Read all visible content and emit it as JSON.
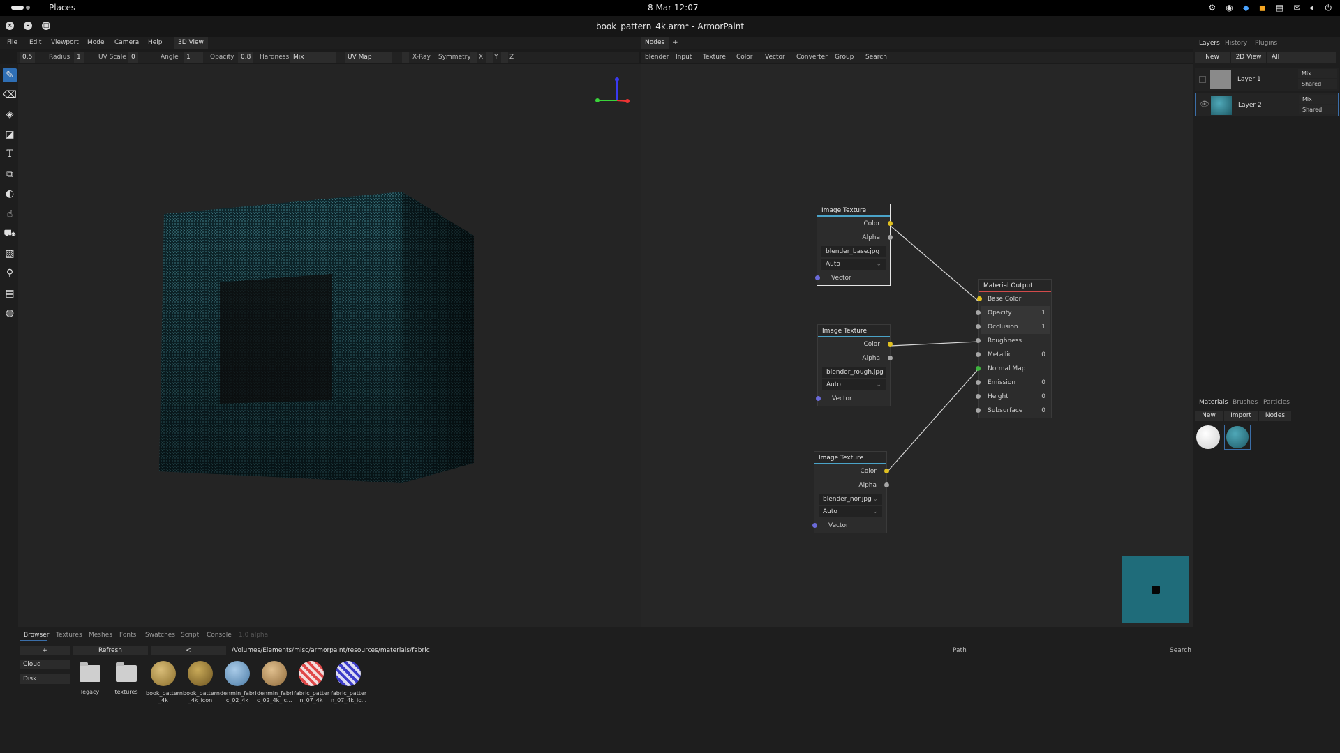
{
  "system": {
    "places": "Places",
    "clock": "8 Mar  12:07",
    "tray_icons": [
      "steam-icon",
      "discord-icon",
      "app-icon",
      "rss-icon",
      "notes-icon",
      "mail-icon",
      "volume-icon",
      "power-icon"
    ]
  },
  "window": {
    "title": "book_pattern_4k.arm* - ArmorPaint"
  },
  "menu": {
    "items": [
      "File",
      "Edit",
      "Viewport",
      "Mode",
      "Camera",
      "Help"
    ],
    "active_tab": "3D View"
  },
  "tool_options": {
    "brush_size": "0.5",
    "radius_label": "Radius",
    "radius": "1",
    "uvscale_label": "UV Scale",
    "uvscale": "0",
    "angle_label": "Angle",
    "angle": "1",
    "opacity_label": "Opacity",
    "opacity": "0.8",
    "hardness_label": "Hardness",
    "blend": "Mix",
    "uvmap": "UV Map",
    "xray": "X-Ray",
    "symmetry": "Symmetry",
    "x": "X",
    "y": "Y",
    "z": "Z"
  },
  "nodes": {
    "tab": "Nodes",
    "add": "+",
    "categories": [
      "blender",
      "Input",
      "Texture",
      "Color",
      "Vector",
      "Converter",
      "Group",
      "Search"
    ],
    "image_textures": [
      {
        "title": "Image Texture",
        "color": "Color",
        "alpha": "Alpha",
        "file": "blender_base.jpg",
        "mode": "Auto",
        "vector": "Vector"
      },
      {
        "title": "Image Texture",
        "color": "Color",
        "alpha": "Alpha",
        "file": "blender_rough.jpg",
        "mode": "Auto",
        "vector": "Vector"
      },
      {
        "title": "Image Texture",
        "color": "Color",
        "alpha": "Alpha",
        "file": "blender_nor.jpg",
        "mode": "Auto",
        "vector": "Vector"
      }
    ],
    "output": {
      "title": "Material Output",
      "inputs": [
        {
          "label": "Base Color",
          "value": ""
        },
        {
          "label": "Opacity",
          "value": "1"
        },
        {
          "label": "Occlusion",
          "value": "1"
        },
        {
          "label": "Roughness",
          "value": ""
        },
        {
          "label": "Metallic",
          "value": "0"
        },
        {
          "label": "Normal Map",
          "value": ""
        },
        {
          "label": "Emission",
          "value": "0"
        },
        {
          "label": "Height",
          "value": "0"
        },
        {
          "label": "Subsurface",
          "value": "0"
        }
      ]
    }
  },
  "right_panel": {
    "tabs": [
      "Layers",
      "History",
      "Plugins"
    ],
    "new": "New",
    "view2d": "2D View",
    "filter": "All",
    "layers": [
      {
        "name": "Layer 1",
        "blend": "Mix",
        "mode": "Shared"
      },
      {
        "name": "Layer 2",
        "blend": "Mix",
        "mode": "Shared"
      }
    ],
    "mat_tabs": [
      "Materials",
      "Brushes",
      "Particles"
    ],
    "mat_new": "New",
    "mat_import": "Import",
    "mat_nodes": "Nodes"
  },
  "browser": {
    "tabs": [
      "Browser",
      "Textures",
      "Meshes",
      "Fonts",
      "Swatches",
      "Script",
      "Console",
      "1.0 alpha"
    ],
    "add": "+",
    "refresh": "Refresh",
    "back": "<",
    "path": "/Volumes/Elements/misc/armorpaint/resources/materials/fabric",
    "path_label": "Path",
    "search": "Search",
    "locations": [
      "Cloud",
      "Disk"
    ],
    "assets": [
      {
        "name": "legacy",
        "kind": "folder",
        "color": ""
      },
      {
        "name": "textures",
        "kind": "folder",
        "color": ""
      },
      {
        "name": "book_pattern_4k",
        "kind": "material",
        "color": "#c9a960"
      },
      {
        "name": "book_pattern_4k_icon",
        "kind": "material",
        "color": "#b89a4a"
      },
      {
        "name": "denmin_fabric_02_4k",
        "kind": "material",
        "color": "#7fa9cf"
      },
      {
        "name": "denmin_fabric_02_4k_ic...",
        "kind": "material",
        "color": "#c8a070"
      },
      {
        "name": "fabric_pattern_07_4k",
        "kind": "material",
        "color": "#e05050"
      },
      {
        "name": "fabric_pattern_07_4k_ic...",
        "kind": "material",
        "color": "#4a4ad0"
      }
    ],
    "asset_labels": [
      [
        "legacy"
      ],
      [
        "textures"
      ],
      [
        "book_pattern",
        "_4k"
      ],
      [
        "book_pattern",
        "_4k_icon"
      ],
      [
        "denmin_fabri",
        "c_02_4k"
      ],
      [
        "denmin_fabri",
        "c_02_4k_ic..."
      ],
      [
        "fabric_patter",
        "n_07_4k"
      ],
      [
        "fabric_patter",
        "n_07_4k_ic..."
      ]
    ]
  }
}
